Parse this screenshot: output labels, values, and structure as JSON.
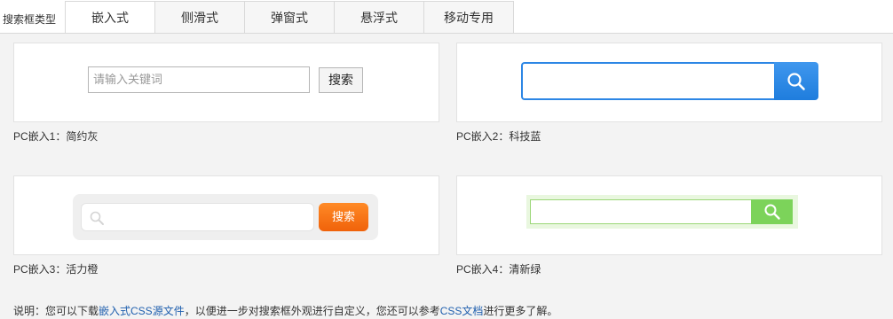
{
  "header": {
    "type_label": "搜索框类型"
  },
  "tabs": [
    {
      "label": "嵌入式",
      "active": true
    },
    {
      "label": "侧滑式"
    },
    {
      "label": "弹窗式"
    },
    {
      "label": "悬浮式"
    },
    {
      "label": "移动专用"
    }
  ],
  "styles": {
    "s1": {
      "placeholder": "请输入关键词",
      "button": "搜索",
      "caption": "PC嵌入1：简约灰"
    },
    "s2": {
      "caption": "PC嵌入2：科技蓝",
      "icon": "search-icon",
      "accent": "#2c86e5"
    },
    "s3": {
      "button": "搜索",
      "caption": "PC嵌入3：活力橙",
      "icon": "search-icon",
      "accent": "#f46c12"
    },
    "s4": {
      "caption": "PC嵌入4：清新绿",
      "icon": "search-icon",
      "accent": "#7cd35a"
    }
  },
  "note": {
    "prefix": "说明：您可以下载",
    "link1": "嵌入式CSS源文件",
    "middle": "，以便进一步对搜索框外观进行自定义，您还可以参考",
    "link2": "CSS文档",
    "suffix": "进行更多了解。"
  }
}
